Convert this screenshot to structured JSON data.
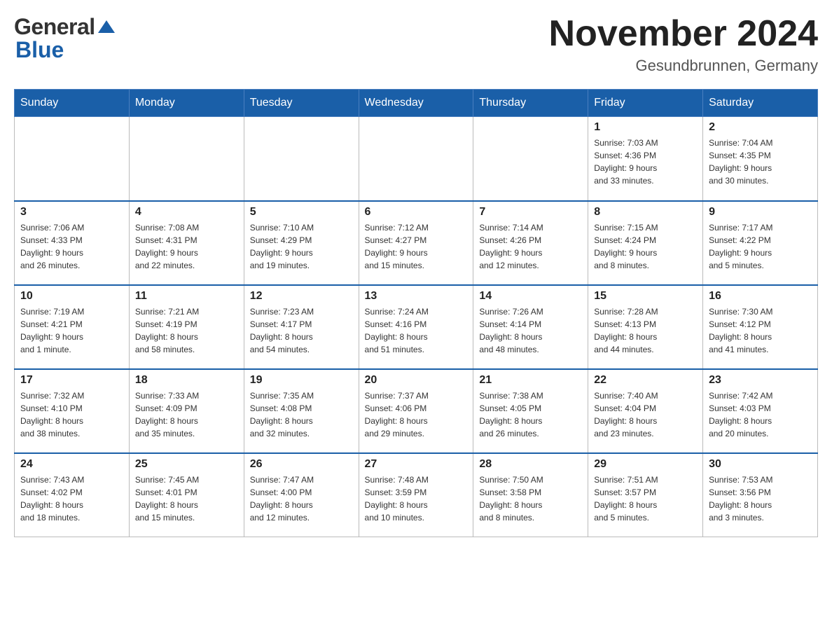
{
  "header": {
    "month_title": "November 2024",
    "location": "Gesundbrunnen, Germany",
    "logo_general": "General",
    "logo_blue": "Blue"
  },
  "weekdays": [
    "Sunday",
    "Monday",
    "Tuesday",
    "Wednesday",
    "Thursday",
    "Friday",
    "Saturday"
  ],
  "weeks": [
    [
      {
        "day": "",
        "info": ""
      },
      {
        "day": "",
        "info": ""
      },
      {
        "day": "",
        "info": ""
      },
      {
        "day": "",
        "info": ""
      },
      {
        "day": "",
        "info": ""
      },
      {
        "day": "1",
        "info": "Sunrise: 7:03 AM\nSunset: 4:36 PM\nDaylight: 9 hours\nand 33 minutes."
      },
      {
        "day": "2",
        "info": "Sunrise: 7:04 AM\nSunset: 4:35 PM\nDaylight: 9 hours\nand 30 minutes."
      }
    ],
    [
      {
        "day": "3",
        "info": "Sunrise: 7:06 AM\nSunset: 4:33 PM\nDaylight: 9 hours\nand 26 minutes."
      },
      {
        "day": "4",
        "info": "Sunrise: 7:08 AM\nSunset: 4:31 PM\nDaylight: 9 hours\nand 22 minutes."
      },
      {
        "day": "5",
        "info": "Sunrise: 7:10 AM\nSunset: 4:29 PM\nDaylight: 9 hours\nand 19 minutes."
      },
      {
        "day": "6",
        "info": "Sunrise: 7:12 AM\nSunset: 4:27 PM\nDaylight: 9 hours\nand 15 minutes."
      },
      {
        "day": "7",
        "info": "Sunrise: 7:14 AM\nSunset: 4:26 PM\nDaylight: 9 hours\nand 12 minutes."
      },
      {
        "day": "8",
        "info": "Sunrise: 7:15 AM\nSunset: 4:24 PM\nDaylight: 9 hours\nand 8 minutes."
      },
      {
        "day": "9",
        "info": "Sunrise: 7:17 AM\nSunset: 4:22 PM\nDaylight: 9 hours\nand 5 minutes."
      }
    ],
    [
      {
        "day": "10",
        "info": "Sunrise: 7:19 AM\nSunset: 4:21 PM\nDaylight: 9 hours\nand 1 minute."
      },
      {
        "day": "11",
        "info": "Sunrise: 7:21 AM\nSunset: 4:19 PM\nDaylight: 8 hours\nand 58 minutes."
      },
      {
        "day": "12",
        "info": "Sunrise: 7:23 AM\nSunset: 4:17 PM\nDaylight: 8 hours\nand 54 minutes."
      },
      {
        "day": "13",
        "info": "Sunrise: 7:24 AM\nSunset: 4:16 PM\nDaylight: 8 hours\nand 51 minutes."
      },
      {
        "day": "14",
        "info": "Sunrise: 7:26 AM\nSunset: 4:14 PM\nDaylight: 8 hours\nand 48 minutes."
      },
      {
        "day": "15",
        "info": "Sunrise: 7:28 AM\nSunset: 4:13 PM\nDaylight: 8 hours\nand 44 minutes."
      },
      {
        "day": "16",
        "info": "Sunrise: 7:30 AM\nSunset: 4:12 PM\nDaylight: 8 hours\nand 41 minutes."
      }
    ],
    [
      {
        "day": "17",
        "info": "Sunrise: 7:32 AM\nSunset: 4:10 PM\nDaylight: 8 hours\nand 38 minutes."
      },
      {
        "day": "18",
        "info": "Sunrise: 7:33 AM\nSunset: 4:09 PM\nDaylight: 8 hours\nand 35 minutes."
      },
      {
        "day": "19",
        "info": "Sunrise: 7:35 AM\nSunset: 4:08 PM\nDaylight: 8 hours\nand 32 minutes."
      },
      {
        "day": "20",
        "info": "Sunrise: 7:37 AM\nSunset: 4:06 PM\nDaylight: 8 hours\nand 29 minutes."
      },
      {
        "day": "21",
        "info": "Sunrise: 7:38 AM\nSunset: 4:05 PM\nDaylight: 8 hours\nand 26 minutes."
      },
      {
        "day": "22",
        "info": "Sunrise: 7:40 AM\nSunset: 4:04 PM\nDaylight: 8 hours\nand 23 minutes."
      },
      {
        "day": "23",
        "info": "Sunrise: 7:42 AM\nSunset: 4:03 PM\nDaylight: 8 hours\nand 20 minutes."
      }
    ],
    [
      {
        "day": "24",
        "info": "Sunrise: 7:43 AM\nSunset: 4:02 PM\nDaylight: 8 hours\nand 18 minutes."
      },
      {
        "day": "25",
        "info": "Sunrise: 7:45 AM\nSunset: 4:01 PM\nDaylight: 8 hours\nand 15 minutes."
      },
      {
        "day": "26",
        "info": "Sunrise: 7:47 AM\nSunset: 4:00 PM\nDaylight: 8 hours\nand 12 minutes."
      },
      {
        "day": "27",
        "info": "Sunrise: 7:48 AM\nSunset: 3:59 PM\nDaylight: 8 hours\nand 10 minutes."
      },
      {
        "day": "28",
        "info": "Sunrise: 7:50 AM\nSunset: 3:58 PM\nDaylight: 8 hours\nand 8 minutes."
      },
      {
        "day": "29",
        "info": "Sunrise: 7:51 AM\nSunset: 3:57 PM\nDaylight: 8 hours\nand 5 minutes."
      },
      {
        "day": "30",
        "info": "Sunrise: 7:53 AM\nSunset: 3:56 PM\nDaylight: 8 hours\nand 3 minutes."
      }
    ]
  ]
}
